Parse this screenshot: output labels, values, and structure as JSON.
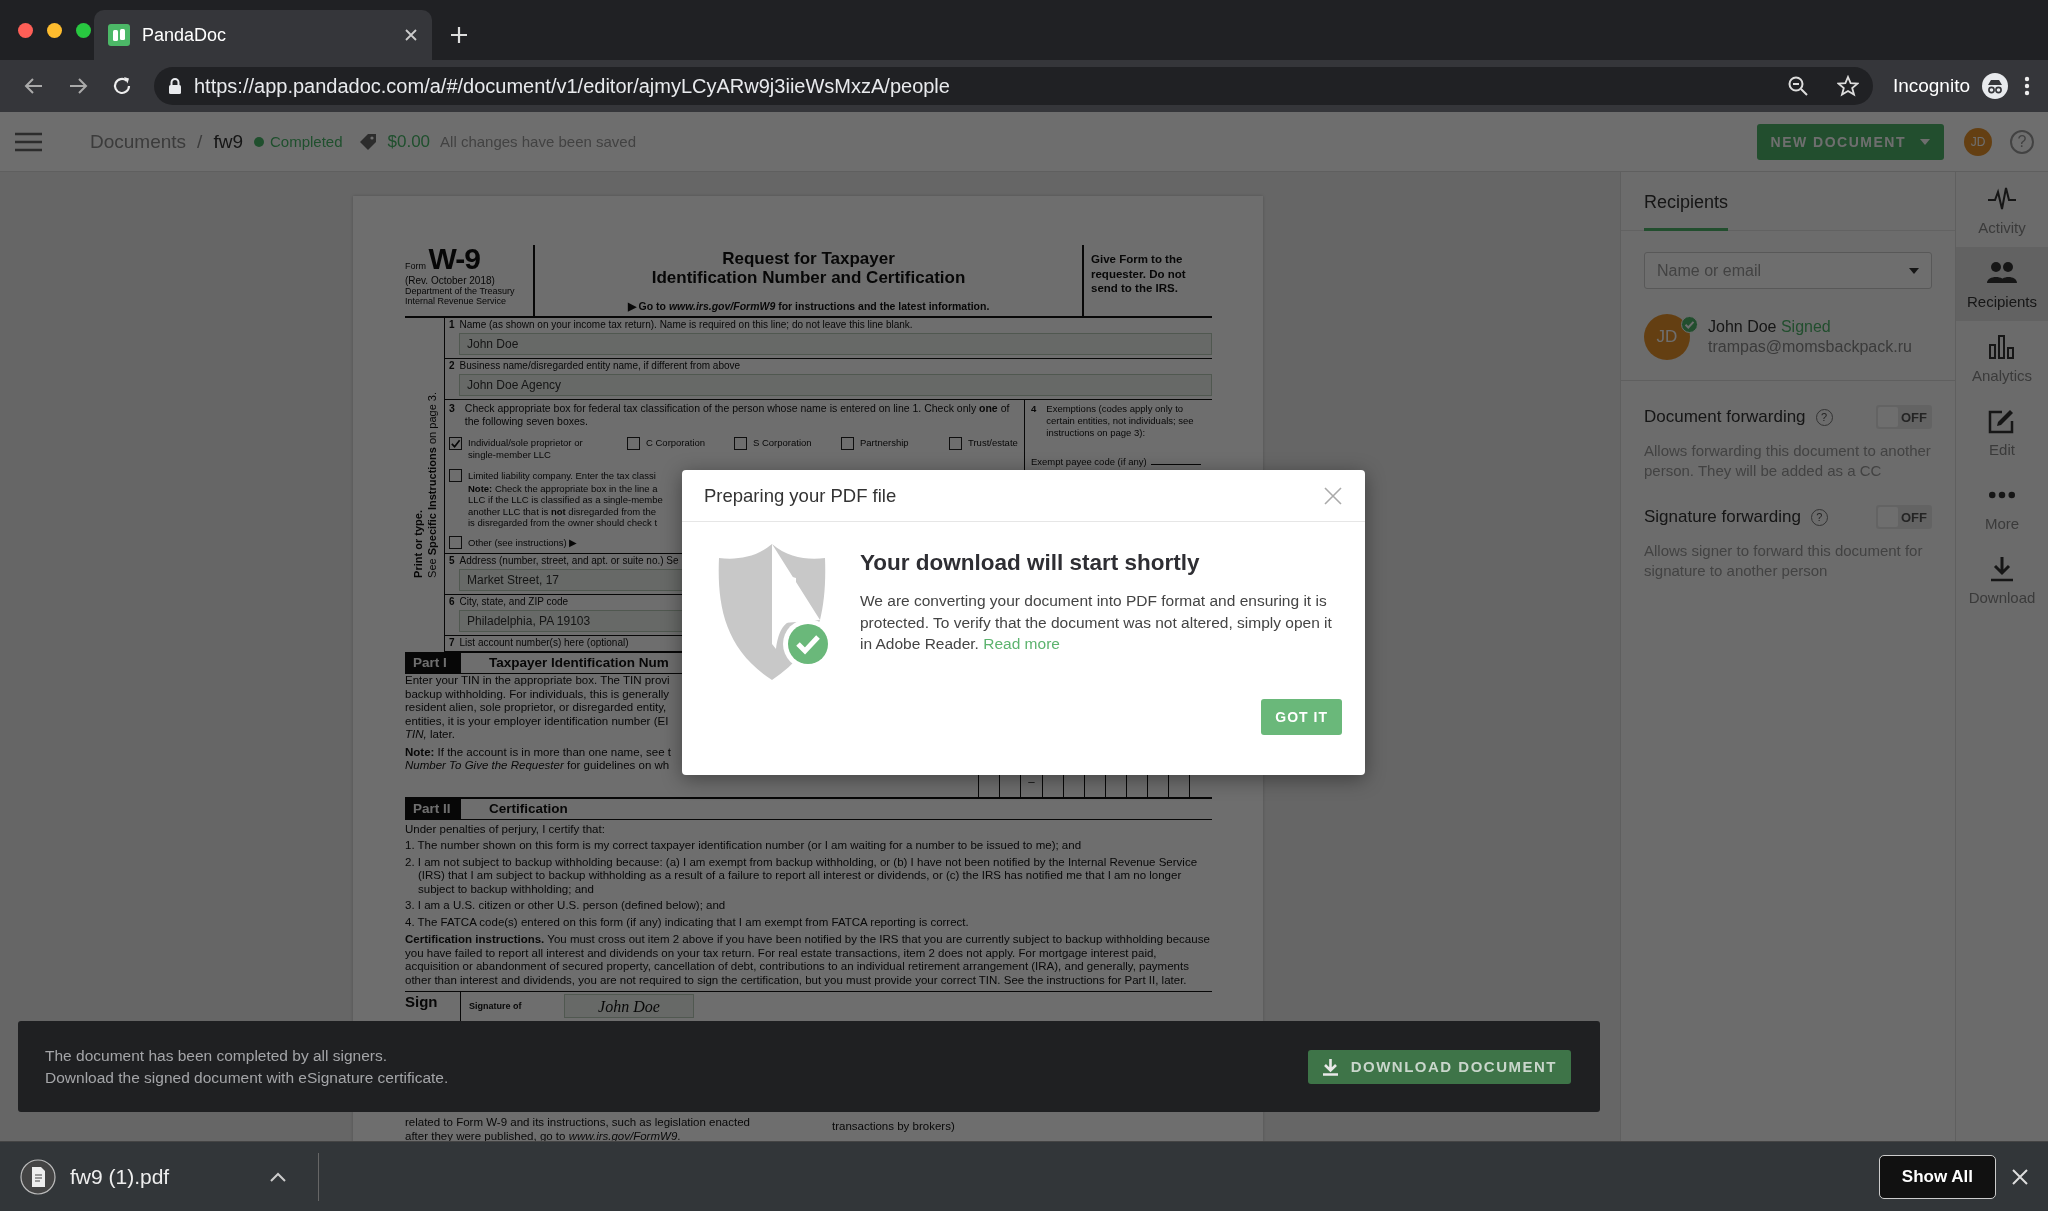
{
  "browser": {
    "tab_title": "PandaDoc",
    "url": "https://app.pandadoc.com/a/#/document/v1/editor/ajmyLCyARw9j3iieWsMxzA/people",
    "profile_label": "Incognito"
  },
  "header": {
    "breadcrumb": [
      "Documents",
      "fw9"
    ],
    "separator": "/",
    "status": "Completed",
    "amount": "$0.00",
    "save_state": "All changes have been saved",
    "new_button": "NEW DOCUMENT",
    "avatar": "JD",
    "help": "?"
  },
  "document": {
    "form_label": "Form",
    "form_number": "W-9",
    "revision": "(Rev. October 2018)",
    "agency": [
      "Department of the Treasury",
      "Internal Revenue Service"
    ],
    "title": [
      "Request for Taxpayer",
      "Identification Number and Certification"
    ],
    "instruction": "▶ Go to *www.irs.gov/FormW9* for instructions and the latest information.",
    "give_form": "Give Form to the requester. Do not send to the IRS.",
    "side_label": [
      "Print or type.",
      "See **Specific Instructions** on page 3."
    ],
    "lines": [
      {
        "number": "1",
        "label": "Name (as shown on your income tax return). Name is required on this line; do not leave this line blank.",
        "value": "John Doe"
      },
      {
        "number": "2",
        "label": "Business name/disregarded entity name, if different from above",
        "value": "John Doe Agency"
      }
    ],
    "classification": {
      "number": "3",
      "label": "Check appropriate box for federal tax classification of the person whose name is entered on line 1. Check only **one** of the following seven boxes.",
      "options": [
        {
          "label": "Individual/sole proprietor or single-member LLC",
          "checked": true
        },
        {
          "label": "C Corporation",
          "checked": false
        },
        {
          "label": "S Corporation",
          "checked": false
        },
        {
          "label": "Partnership",
          "checked": false
        },
        {
          "label": "Trust/estate",
          "checked": false
        }
      ],
      "llc": {
        "label": "Limited liability company. Enter the tax classi",
        "checked": false
      },
      "note": "**Note:** Check the appropriate box in the line a\nLLC if the LLC is classified as a single-membe\nanother LLC that is **not** disregarded from the\nis disregarded from the owner should check t",
      "other": {
        "label": "Other (see instructions) ▶",
        "checked": false
      }
    },
    "exemptions": {
      "number": "4",
      "label": "Exemptions (codes apply only to certain entities, not individuals; see instructions on page 3):",
      "payee_code": "Exempt payee code (if any)"
    },
    "address_lines": [
      {
        "number": "5",
        "label": "Address (number, street, and apt. or suite no.) Se",
        "value": "Market Street, 17"
      },
      {
        "number": "6",
        "label": "City, state, and ZIP code",
        "value": "Philadelphia, PA 19103"
      },
      {
        "number": "7",
        "label": "List account number(s) here (optional)"
      }
    ],
    "part1": {
      "tag": "Part I",
      "title": "Taxpayer Identification Num",
      "text": "Enter your TIN in the appropriate box. The TIN provi\nbackup withholding. For individuals, this is generally\nresident alien, sole proprietor, or disregarded entity,\nentities, it is your employer identification number (EI\n*TIN,* later.",
      "note": "**Note:** If the account is in more than one name, see t\n*Number To Give the Requester* for guidelines on wh"
    },
    "tin_separator": "–",
    "part2": {
      "tag": "Part II",
      "title": "Certification",
      "intro": "Under penalties of perjury, I certify that:",
      "items": [
        "1. The number shown on this form is my correct taxpayer identification number (or I am waiting for a number to be issued to me); and",
        "2. I am not subject to backup withholding because: (a) I am exempt from backup withholding, or (b) I have not been notified by the Internal Revenue Service (IRS) that I am subject to backup withholding as a result of a failure to report all interest or dividends, or (c) the IRS has notified me that I am no longer subject to backup withholding; and",
        "3. I am a U.S. citizen or other U.S. person (defined below); and",
        "4. The FATCA code(s) entered on this form (if any) indicating that I am exempt from FATCA reporting is correct."
      ],
      "instructions": "**Certification instructions.** You must cross out item 2 above if you have been notified by the IRS that you are currently subject to backup withholding because you have failed to report all interest and dividends on your tax return. For real estate transactions, item 2 does not apply. For mortgage interest paid, acquisition or abandonment of secured property, cancellation of debt, contributions to an individual retirement arrangement (IRA), and generally, payments other than interest and dividends, you are not required to sign the certification, but you must provide your correct TIN. See the instructions for Part II, later."
    },
    "sign": {
      "label": "Sign",
      "signature_label": "Signature of",
      "signature": "John Doe"
    },
    "footer_left": "related to Form W-9 and its instructions, such as legislation enacted\nafter they were published, go to *www.irs.gov/FormW9*.",
    "footer_right": "transactions by brokers)"
  },
  "recipients_panel": {
    "tab": "Recipients",
    "search": {
      "placeholder": "Name or email"
    },
    "recipients": [
      {
        "initials": "JD",
        "name": "John Doe",
        "status": "Signed",
        "email": "trampas@momsbackpack.ru",
        "signed": true
      }
    ],
    "settings": [
      {
        "label": "Document forwarding",
        "help": "?",
        "on": false,
        "toggle_text": "OFF",
        "description": "Allows forwarding this document to another person. They will be added as a CC"
      },
      {
        "label": "Signature forwarding",
        "help": "?",
        "on": false,
        "toggle_text": "OFF",
        "description": "Allows signer to forward this document for signature to another person"
      }
    ]
  },
  "rail": [
    {
      "label": "Activity",
      "selected": false
    },
    {
      "label": "Recipients",
      "selected": true
    },
    {
      "label": "Analytics",
      "selected": false
    },
    {
      "label": "Edit",
      "selected": false
    },
    {
      "label": "More",
      "selected": false
    },
    {
      "label": "Download",
      "selected": false
    }
  ],
  "banner": {
    "lines": [
      "The document has been completed by all signers.",
      "Download the signed document with eSignature certificate."
    ],
    "button": "DOWNLOAD DOCUMENT"
  },
  "modal": {
    "title": "Preparing your PDF file",
    "heading": "Your download will start shortly",
    "body": "We are converting your document into PDF format and ensuring it is protected. To verify that the document was not altered, simply open it in Adobe Reader.",
    "link": "Read more",
    "button": "GOT IT"
  },
  "download_bar": {
    "file": "fw9 (1).pdf",
    "show_all": "Show All"
  }
}
